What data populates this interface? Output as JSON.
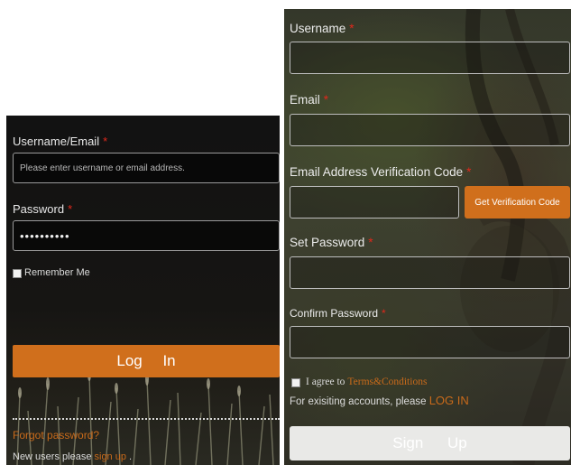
{
  "login": {
    "username_label": "Username/Email",
    "username_placeholder": "Please enter username or email address.",
    "password_label": "Password",
    "password_value": "••••••••••",
    "remember_label": "Remember Me",
    "login_button": "Log In",
    "forgot_link": "Forgot password?",
    "new_users_text": "New users please",
    "signup_link": "sign up",
    "trailing_period": "."
  },
  "signup": {
    "username_label": "Username",
    "email_label": "Email",
    "code_label": "Email Address Verification Code",
    "get_code_button": "Get Verification Code",
    "set_password_label": "Set Password",
    "confirm_password_label": "Confirm Password",
    "agree_text": "I agree to",
    "terms_link": "Terms&Conditions",
    "existing_text": "For exisiting accounts, please",
    "login_link": "LOG IN",
    "signup_button": "Sign Up"
  },
  "required_mark": "*",
  "colors": {
    "accent": "#d06f1c",
    "required": "#e0281c",
    "link": "#c96a1a"
  }
}
